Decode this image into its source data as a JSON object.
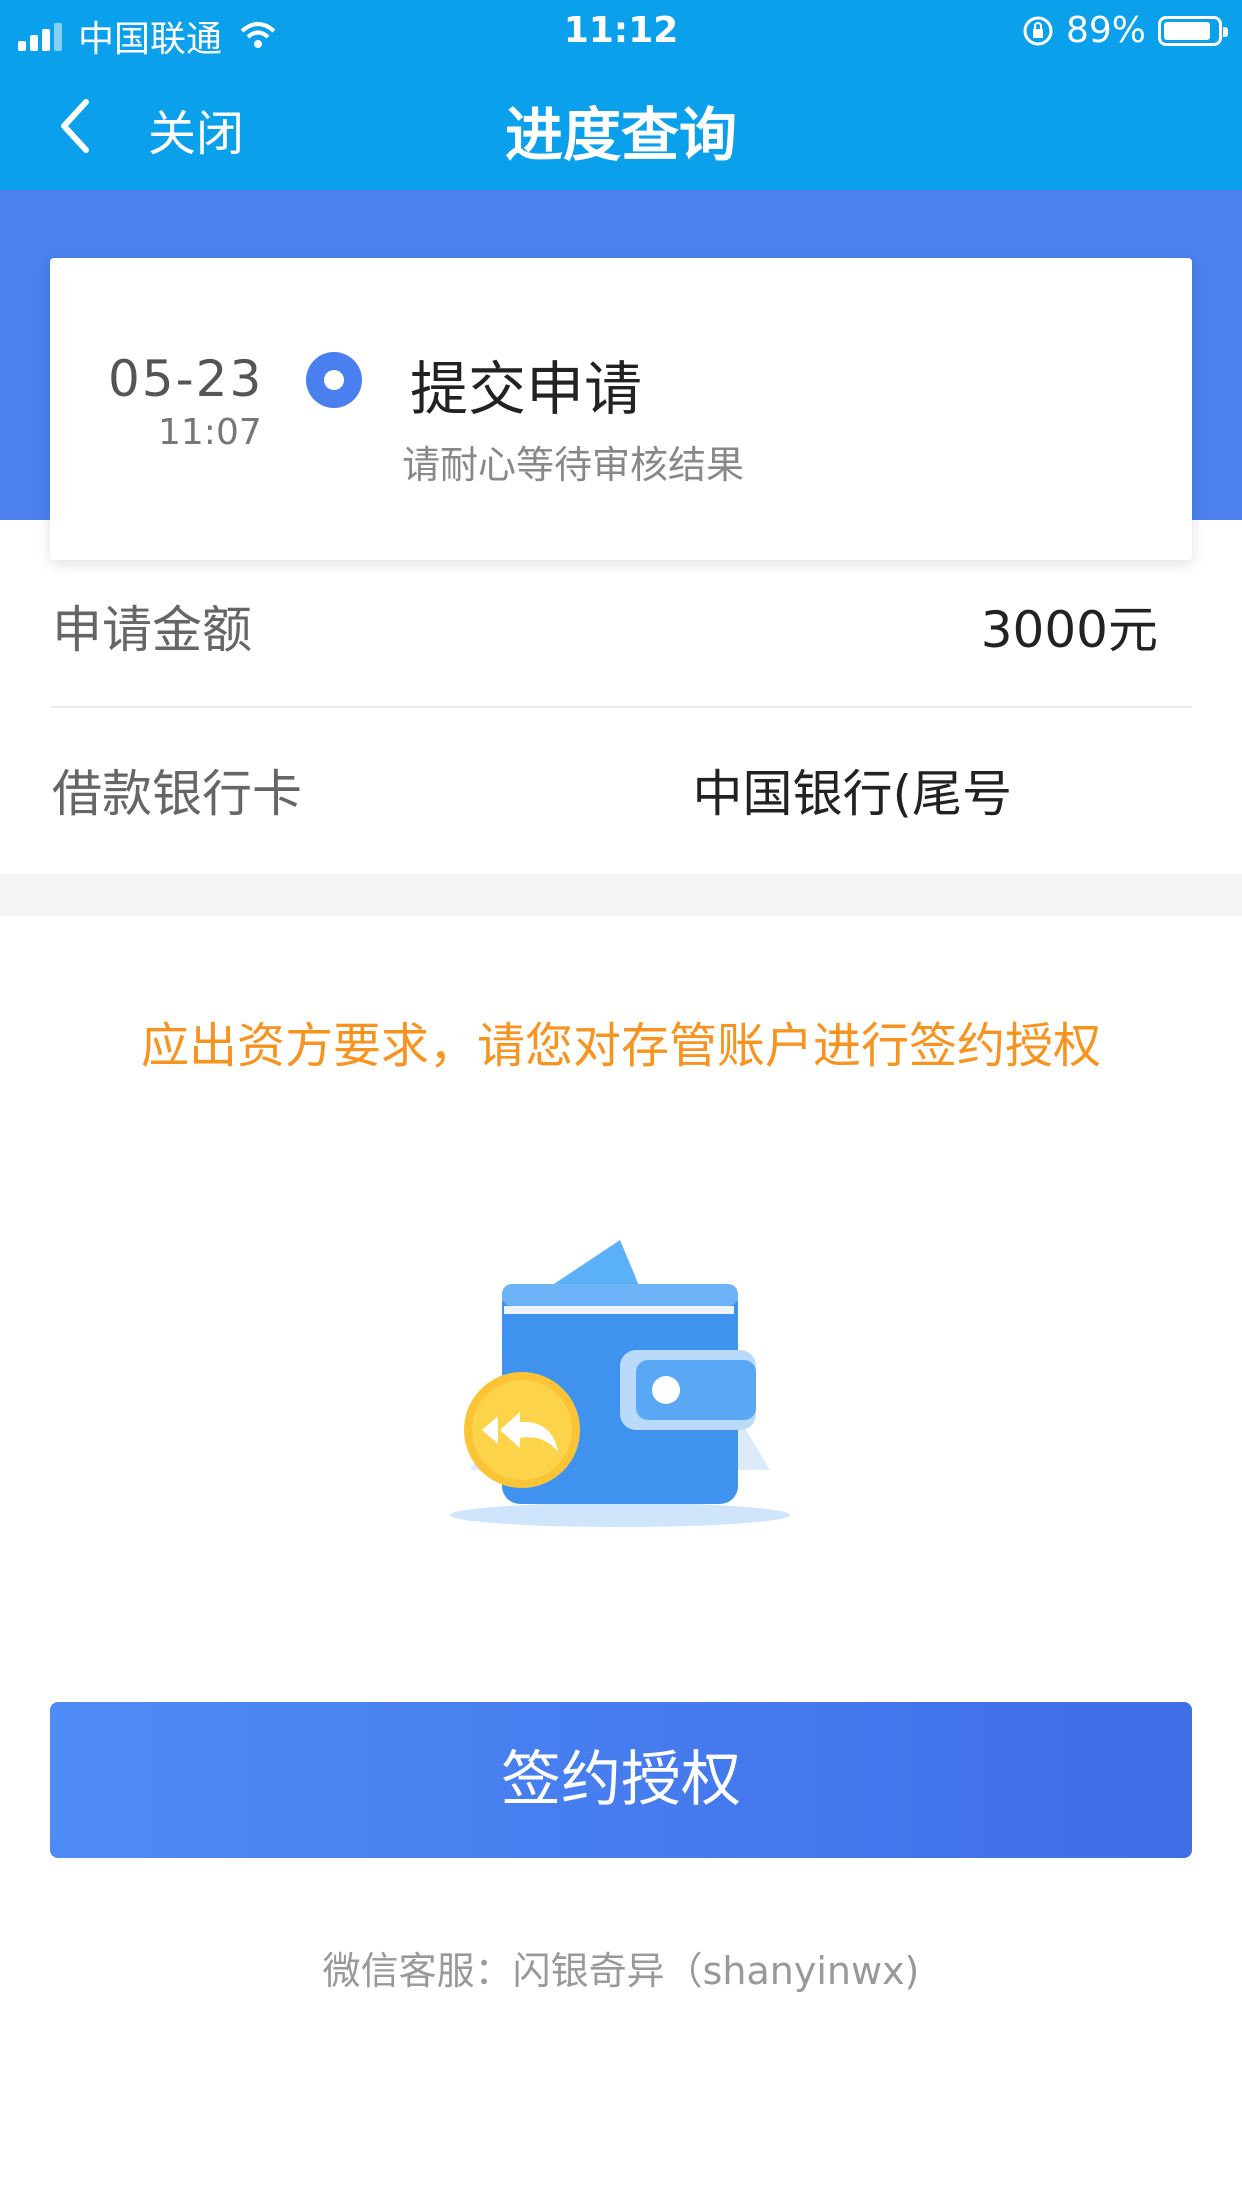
{
  "status_bar": {
    "carrier": "中国联通",
    "time": "11:12",
    "battery": "89%",
    "battery_level": 0.89
  },
  "nav": {
    "close_label": "关闭",
    "title": "进度查询"
  },
  "progress": {
    "date": "05-23",
    "time": "11:07",
    "status": "提交申请",
    "subtitle": "请耐心等待审核结果"
  },
  "details": {
    "amount_label": "申请金额",
    "amount_value": "3000元",
    "card_label": "借款银行卡",
    "card_value": "中国银行(尾号"
  },
  "notice": "应出资方要求，请您对存管账户进行签约授权",
  "button_label": "签约授权",
  "footer": "微信客服：闪银奇异（shanyinwx)",
  "colors": {
    "header": "#0aa0ec",
    "band": "#4c80ee",
    "accent": "#f7931e",
    "button": "#4479ee"
  }
}
